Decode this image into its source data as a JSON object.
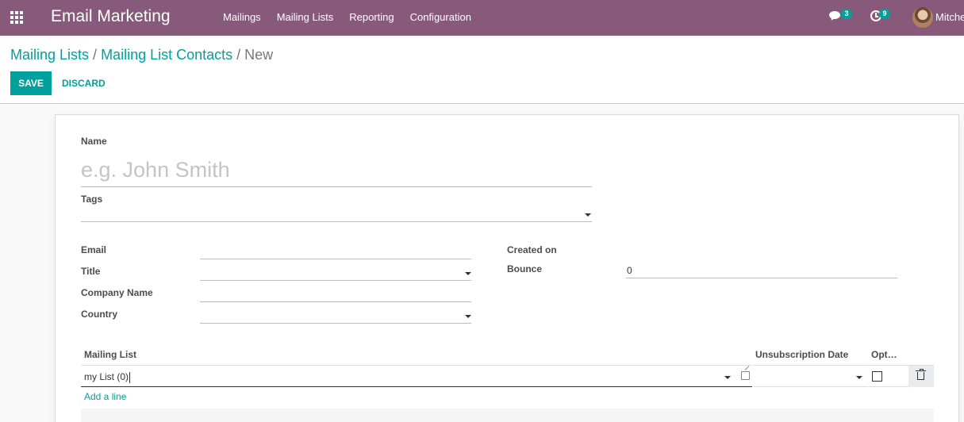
{
  "navbar": {
    "brand": "Email Marketing",
    "menu": [
      {
        "label": "Mailings"
      },
      {
        "label": "Mailing Lists"
      },
      {
        "label": "Reporting"
      },
      {
        "label": "Configuration"
      }
    ],
    "messages_count": "3",
    "activities_count": "9",
    "user_name": "Mitche",
    "colors": {
      "navbar_bg": "#875a7b",
      "accent": "#00a09d"
    }
  },
  "breadcrumb": {
    "items": [
      "Mailing Lists",
      "Mailing List Contacts"
    ],
    "separator": "/",
    "current": "New"
  },
  "actions": {
    "save_label": "SAVE",
    "discard_label": "DISCARD"
  },
  "form": {
    "name_label": "Name",
    "name_placeholder": "e.g. John Smith",
    "name_value": "",
    "tags_label": "Tags",
    "email_label": "Email",
    "title_label": "Title",
    "company_label": "Company Name",
    "country_label": "Country",
    "created_on_label": "Created on",
    "bounce_label": "Bounce",
    "bounce_value": "0"
  },
  "subscriptions": {
    "columns": {
      "mailing_list": "Mailing List",
      "unsub_date": "Unsubscription Date",
      "opt_out": "Opt…"
    },
    "rows": [
      {
        "mailing_list": "my List (0)",
        "unsub_date": "",
        "opt_out": false
      }
    ],
    "add_line_label": "Add a line"
  },
  "icons": [
    "apps-icon",
    "chat-icon",
    "activity-icon",
    "caret-down-icon",
    "external-link-icon",
    "trash-icon"
  ]
}
